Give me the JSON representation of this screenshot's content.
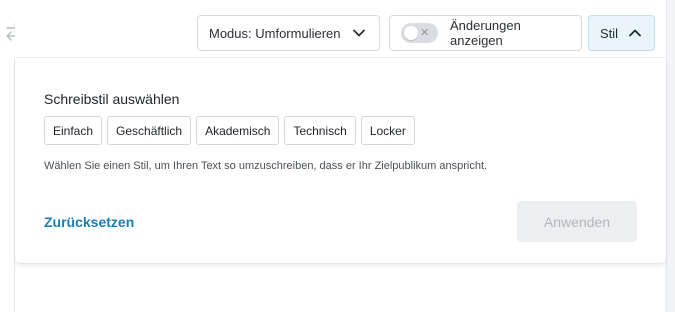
{
  "toolbar": {
    "mode_label": "Modus: Umformulieren",
    "changes_label": "Änderungen anzeigen",
    "toggle_state": "off",
    "style_label": "Stil"
  },
  "style_panel": {
    "title": "Schreibstil auswählen",
    "options": [
      "Einfach",
      "Geschäftlich",
      "Akademisch",
      "Technisch",
      "Locker"
    ],
    "description": "Wählen Sie einen Stil, um Ihren Text so umzuschreiben, dass er Ihr Zielpublikum anspricht.",
    "reset_label": "Zurücksetzen",
    "apply_label": "Anwenden",
    "apply_enabled": false
  },
  "colors": {
    "accent": "#1a7db3",
    "style_button_bg": "#e9f5fb",
    "disabled_bg": "#eceef1"
  },
  "icons": {
    "swap": "swap-arrows-icon",
    "chevron_down": "chevron-down-icon",
    "chevron_up": "chevron-up-icon",
    "toggle_x": "close-icon"
  }
}
